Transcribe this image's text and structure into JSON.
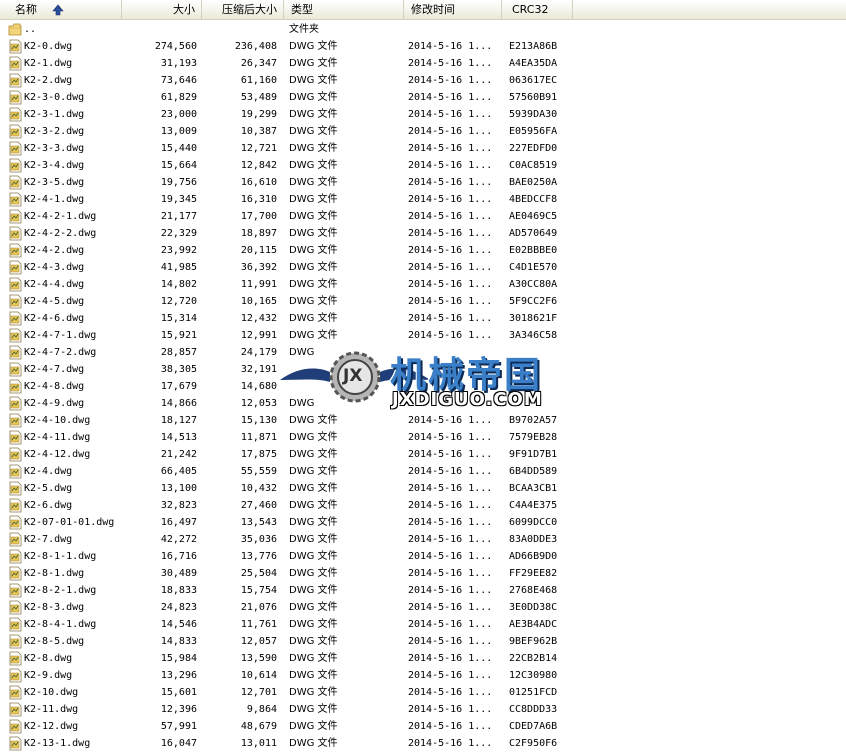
{
  "columns": {
    "name": "名称",
    "size": "大小",
    "compressed": "压缩后大小",
    "type": "类型",
    "modified": "修改时间",
    "crc": "CRC32"
  },
  "icons": {
    "sort": "sort-ascending-icon",
    "file": "dwg-file-icon",
    "folder": "folder-icon"
  },
  "parent_row": {
    "name": "..",
    "type": "文件夹"
  },
  "files": [
    {
      "name": "K2-0.dwg",
      "size": "274,560",
      "compressed": "236,408",
      "type": "DWG 文件",
      "modified": "2014-5-16 1...",
      "crc": "E213A86B"
    },
    {
      "name": "K2-1.dwg",
      "size": "31,193",
      "compressed": "26,347",
      "type": "DWG 文件",
      "modified": "2014-5-16 1...",
      "crc": "A4EA35DA"
    },
    {
      "name": "K2-2.dwg",
      "size": "73,646",
      "compressed": "61,160",
      "type": "DWG 文件",
      "modified": "2014-5-16 1...",
      "crc": "063617EC"
    },
    {
      "name": "K2-3-0.dwg",
      "size": "61,829",
      "compressed": "53,489",
      "type": "DWG 文件",
      "modified": "2014-5-16 1...",
      "crc": "57560B91"
    },
    {
      "name": "K2-3-1.dwg",
      "size": "23,000",
      "compressed": "19,299",
      "type": "DWG 文件",
      "modified": "2014-5-16 1...",
      "crc": "5939DA30"
    },
    {
      "name": "K2-3-2.dwg",
      "size": "13,009",
      "compressed": "10,387",
      "type": "DWG 文件",
      "modified": "2014-5-16 1...",
      "crc": "E05956FA"
    },
    {
      "name": "K2-3-3.dwg",
      "size": "15,440",
      "compressed": "12,721",
      "type": "DWG 文件",
      "modified": "2014-5-16 1...",
      "crc": "227EDFD0"
    },
    {
      "name": "K2-3-4.dwg",
      "size": "15,664",
      "compressed": "12,842",
      "type": "DWG 文件",
      "modified": "2014-5-16 1...",
      "crc": "C0AC8519"
    },
    {
      "name": "K2-3-5.dwg",
      "size": "19,756",
      "compressed": "16,610",
      "type": "DWG 文件",
      "modified": "2014-5-16 1...",
      "crc": "BAE0250A"
    },
    {
      "name": "K2-4-1.dwg",
      "size": "19,345",
      "compressed": "16,310",
      "type": "DWG 文件",
      "modified": "2014-5-16 1...",
      "crc": "4BEDCCF8"
    },
    {
      "name": "K2-4-2-1.dwg",
      "size": "21,177",
      "compressed": "17,700",
      "type": "DWG 文件",
      "modified": "2014-5-16 1...",
      "crc": "AE0469C5"
    },
    {
      "name": "K2-4-2-2.dwg",
      "size": "22,329",
      "compressed": "18,897",
      "type": "DWG 文件",
      "modified": "2014-5-16 1...",
      "crc": "AD570649"
    },
    {
      "name": "K2-4-2.dwg",
      "size": "23,992",
      "compressed": "20,115",
      "type": "DWG 文件",
      "modified": "2014-5-16 1...",
      "crc": "E02BBBE0"
    },
    {
      "name": "K2-4-3.dwg",
      "size": "41,985",
      "compressed": "36,392",
      "type": "DWG 文件",
      "modified": "2014-5-16 1...",
      "crc": "C4D1E570"
    },
    {
      "name": "K2-4-4.dwg",
      "size": "14,802",
      "compressed": "11,991",
      "type": "DWG 文件",
      "modified": "2014-5-16 1...",
      "crc": "A30CC80A"
    },
    {
      "name": "K2-4-5.dwg",
      "size": "12,720",
      "compressed": "10,165",
      "type": "DWG 文件",
      "modified": "2014-5-16 1...",
      "crc": "5F9CC2F6"
    },
    {
      "name": "K2-4-6.dwg",
      "size": "15,314",
      "compressed": "12,432",
      "type": "DWG 文件",
      "modified": "2014-5-16 1...",
      "crc": "3018621F"
    },
    {
      "name": "K2-4-7-1.dwg",
      "size": "15,921",
      "compressed": "12,991",
      "type": "DWG 文件",
      "modified": "2014-5-16 1...",
      "crc": "3A346C58"
    },
    {
      "name": "K2-4-7-2.dwg",
      "size": "28,857",
      "compressed": "24,179",
      "type": "DWG",
      "modified": "",
      "crc": ""
    },
    {
      "name": "K2-4-7.dwg",
      "size": "38,305",
      "compressed": "32,191",
      "type": "",
      "modified": "",
      "crc": ""
    },
    {
      "name": "K2-4-8.dwg",
      "size": "17,679",
      "compressed": "14,680",
      "type": "",
      "modified": "",
      "crc": ""
    },
    {
      "name": "K2-4-9.dwg",
      "size": "14,866",
      "compressed": "12,053",
      "type": "DWG",
      "modified": "",
      "crc": ""
    },
    {
      "name": "K2-4-10.dwg",
      "size": "18,127",
      "compressed": "15,130",
      "type": "DWG 文件",
      "modified": "2014-5-16 1...",
      "crc": "B9702A57"
    },
    {
      "name": "K2-4-11.dwg",
      "size": "14,513",
      "compressed": "11,871",
      "type": "DWG 文件",
      "modified": "2014-5-16 1...",
      "crc": "7579EB28"
    },
    {
      "name": "K2-4-12.dwg",
      "size": "21,242",
      "compressed": "17,875",
      "type": "DWG 文件",
      "modified": "2014-5-16 1...",
      "crc": "9F91D7B1"
    },
    {
      "name": "K2-4.dwg",
      "size": "66,405",
      "compressed": "55,559",
      "type": "DWG 文件",
      "modified": "2014-5-16 1...",
      "crc": "6B4DD589"
    },
    {
      "name": "K2-5.dwg",
      "size": "13,100",
      "compressed": "10,432",
      "type": "DWG 文件",
      "modified": "2014-5-16 1...",
      "crc": "BCAA3CB1"
    },
    {
      "name": "K2-6.dwg",
      "size": "32,823",
      "compressed": "27,460",
      "type": "DWG 文件",
      "modified": "2014-5-16 1...",
      "crc": "C4A4E375"
    },
    {
      "name": "K2-07-01-01.dwg",
      "size": "16,497",
      "compressed": "13,543",
      "type": "DWG 文件",
      "modified": "2014-5-16 1...",
      "crc": "6099DCC0"
    },
    {
      "name": "K2-7.dwg",
      "size": "42,272",
      "compressed": "35,036",
      "type": "DWG 文件",
      "modified": "2014-5-16 1...",
      "crc": "83A0DDE3"
    },
    {
      "name": "K2-8-1-1.dwg",
      "size": "16,716",
      "compressed": "13,776",
      "type": "DWG 文件",
      "modified": "2014-5-16 1...",
      "crc": "AD66B9D0"
    },
    {
      "name": "K2-8-1.dwg",
      "size": "30,489",
      "compressed": "25,504",
      "type": "DWG 文件",
      "modified": "2014-5-16 1...",
      "crc": "FF29EE82"
    },
    {
      "name": "K2-8-2-1.dwg",
      "size": "18,833",
      "compressed": "15,754",
      "type": "DWG 文件",
      "modified": "2014-5-16 1...",
      "crc": "2768E468"
    },
    {
      "name": "K2-8-3.dwg",
      "size": "24,823",
      "compressed": "21,076",
      "type": "DWG 文件",
      "modified": "2014-5-16 1...",
      "crc": "3E0DD38C"
    },
    {
      "name": "K2-8-4-1.dwg",
      "size": "14,546",
      "compressed": "11,761",
      "type": "DWG 文件",
      "modified": "2014-5-16 1...",
      "crc": "AE3B4ADC"
    },
    {
      "name": "K2-8-5.dwg",
      "size": "14,833",
      "compressed": "12,057",
      "type": "DWG 文件",
      "modified": "2014-5-16 1...",
      "crc": "9BEF962B"
    },
    {
      "name": "K2-8.dwg",
      "size": "15,984",
      "compressed": "13,590",
      "type": "DWG 文件",
      "modified": "2014-5-16 1...",
      "crc": "22CB2B14"
    },
    {
      "name": "K2-9.dwg",
      "size": "13,296",
      "compressed": "10,614",
      "type": "DWG 文件",
      "modified": "2014-5-16 1...",
      "crc": "12C30980"
    },
    {
      "name": "K2-10.dwg",
      "size": "15,601",
      "compressed": "12,701",
      "type": "DWG 文件",
      "modified": "2014-5-16 1...",
      "crc": "01251FCD"
    },
    {
      "name": "K2-11.dwg",
      "size": "12,396",
      "compressed": "9,864",
      "type": "DWG 文件",
      "modified": "2014-5-16 1...",
      "crc": "CC8DDD33"
    },
    {
      "name": "K2-12.dwg",
      "size": "57,991",
      "compressed": "48,679",
      "type": "DWG 文件",
      "modified": "2014-5-16 1...",
      "crc": "CDED7A6B"
    },
    {
      "name": "K2-13-1.dwg",
      "size": "16,047",
      "compressed": "13,011",
      "type": "DWG 文件",
      "modified": "2014-5-16 1...",
      "crc": "C2F950F6"
    }
  ],
  "watermark": {
    "logo_text": "JX",
    "title": "机械帝国",
    "url": "JXDIGUO.COM"
  },
  "colors": {
    "header_bg": "#ece9d8",
    "watermark_blue": "#3a7fc8",
    "icon_yellow": "#e8c65a"
  }
}
